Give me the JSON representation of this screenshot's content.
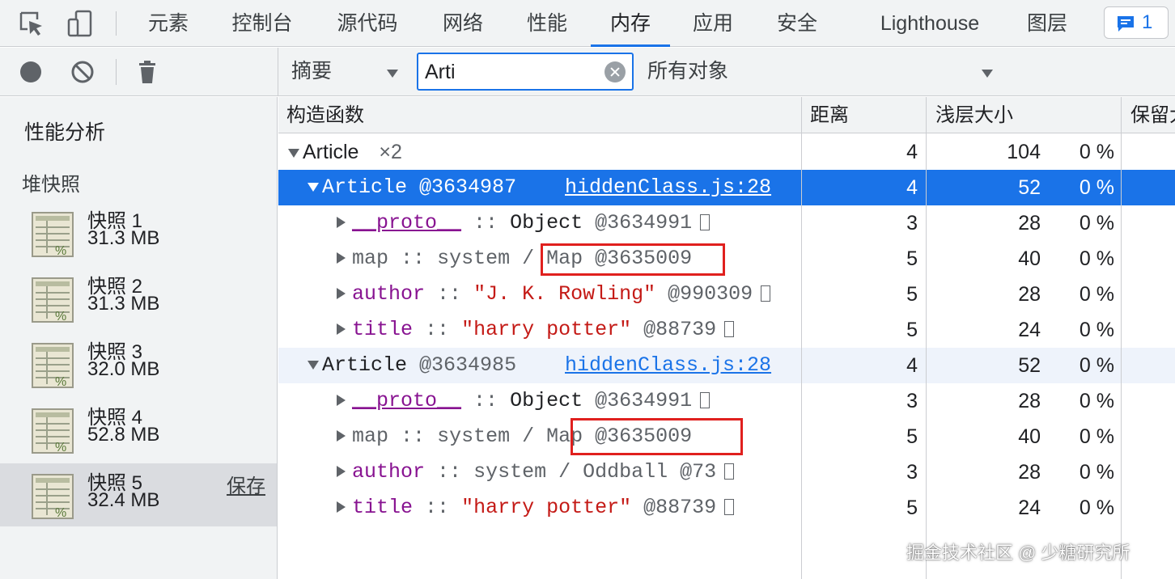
{
  "tabs": [
    {
      "label": "元素"
    },
    {
      "label": "控制台"
    },
    {
      "label": "源代码"
    },
    {
      "label": "网络"
    },
    {
      "label": "性能"
    },
    {
      "label": "内存"
    },
    {
      "label": "应用"
    },
    {
      "label": "安全"
    },
    {
      "label": "Lighthouse"
    },
    {
      "label": "图层"
    }
  ],
  "active_tab": "内存",
  "issues_count": "1",
  "toolbar": {
    "view_mode": "摘要",
    "filter_value": "Arti",
    "object_filter": "所有对象"
  },
  "sidebar": {
    "title": "性能分析",
    "section": "堆快照",
    "save_label": "保存",
    "snapshots": [
      {
        "name": "快照 1",
        "size": "31.3 MB"
      },
      {
        "name": "快照 2",
        "size": "31.3 MB"
      },
      {
        "name": "快照 3",
        "size": "32.0 MB"
      },
      {
        "name": "快照 4",
        "size": "52.8 MB"
      },
      {
        "name": "快照 5",
        "size": "32.4 MB"
      }
    ]
  },
  "grid": {
    "headers": {
      "constructor": "构造函数",
      "distance": "距离",
      "shallow": "浅层大小",
      "retained": "保留大小"
    },
    "rows": [
      {
        "name": "Article",
        "count": "×2",
        "distance": "4",
        "shallow": "104",
        "pct": "0 %"
      },
      {
        "ctor": "Article",
        "id": "@3634987",
        "link": "hiddenClass.js:28",
        "distance": "4",
        "shallow": "52",
        "pct": "0 %"
      },
      {
        "prop": "__proto__",
        "sep": "::",
        "type": "Object",
        "id": "@3634991",
        "distance": "3",
        "shallow": "28",
        "pct": "0 %"
      },
      {
        "prop": "map",
        "sep": "::",
        "type": "system / Map",
        "id": "@3635009",
        "distance": "5",
        "shallow": "40",
        "pct": "0 %"
      },
      {
        "prop": "author",
        "sep": "::",
        "value": "\"J. K. Rowling\"",
        "id": "@990309",
        "distance": "5",
        "shallow": "28",
        "pct": "0 %"
      },
      {
        "prop": "title",
        "sep": "::",
        "value": "\"harry potter\"",
        "id": "@88739",
        "distance": "5",
        "shallow": "24",
        "pct": "0 %"
      },
      {
        "ctor": "Article",
        "id": "@3634985",
        "link": "hiddenClass.js:28",
        "distance": "4",
        "shallow": "52",
        "pct": "0 %"
      },
      {
        "prop": "__proto__",
        "sep": "::",
        "type": "Object",
        "id": "@3634991",
        "distance": "3",
        "shallow": "28",
        "pct": "0 %"
      },
      {
        "prop": "map",
        "sep": "::",
        "type": "system / Map",
        "id": "@3635009",
        "distance": "5",
        "shallow": "40",
        "pct": "0 %"
      },
      {
        "prop": "author",
        "sep": "::",
        "type": "system / Oddball",
        "id": "@73",
        "distance": "3",
        "shallow": "28",
        "pct": "0 %"
      },
      {
        "prop": "title",
        "sep": "::",
        "value": "\"harry potter\"",
        "id": "@88739",
        "distance": "5",
        "shallow": "24",
        "pct": "0 %"
      }
    ]
  },
  "watermark": "掘金技术社区 @ 少糖研究所",
  "colors": {
    "accent": "#1a73e8",
    "highlight_box": "#e0201e",
    "property": "#881391",
    "string": "#c41a16"
  }
}
